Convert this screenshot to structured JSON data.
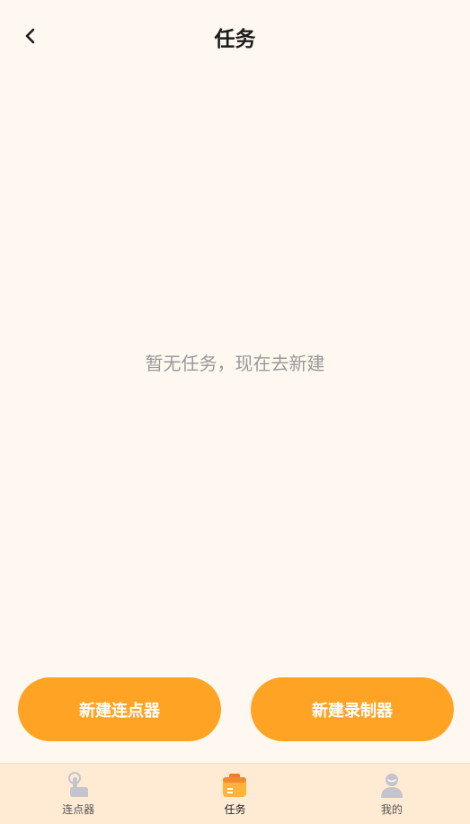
{
  "header": {
    "title": "任务",
    "back_icon": "chevron-left-icon"
  },
  "main": {
    "empty_message": "暂无任务，现在去新建"
  },
  "actions": {
    "new_clicker_label": "新建连点器",
    "new_recorder_label": "新建录制器"
  },
  "tabbar": {
    "items": [
      {
        "label": "连点器",
        "icon": "tap-hand-icon",
        "active": false
      },
      {
        "label": "任务",
        "icon": "task-box-icon",
        "active": true
      },
      {
        "label": "我的",
        "icon": "user-profile-icon",
        "active": false
      }
    ]
  },
  "colors": {
    "background": "#FFF8F0",
    "accent": "#FFA324",
    "tabbar_background": "#FFEBD4",
    "empty_text": "#999999"
  }
}
